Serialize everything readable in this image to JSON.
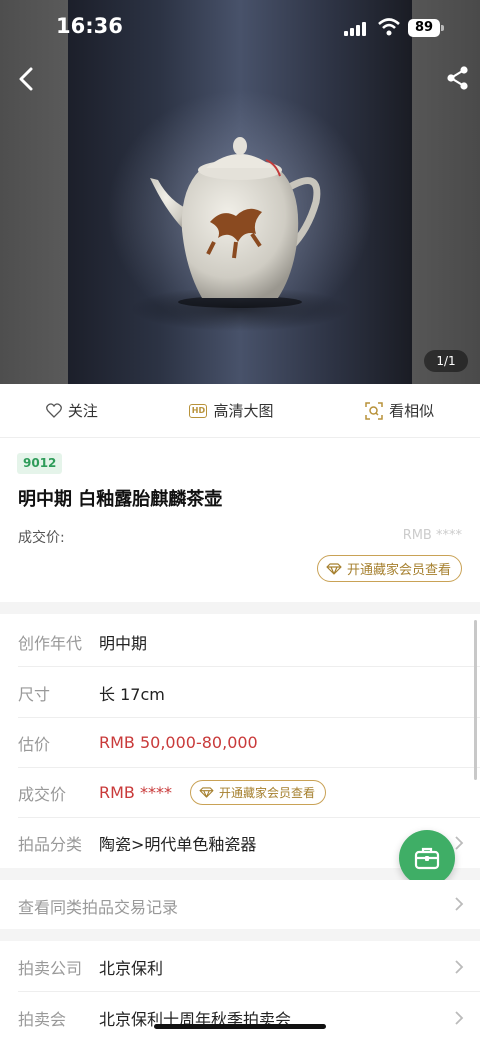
{
  "status_bar": {
    "time": "16:36",
    "battery": "89"
  },
  "hero": {
    "image_counter": "1/1"
  },
  "actions": [
    {
      "label": "关注",
      "icon": "heart-outline-icon"
    },
    {
      "label": "高清大图",
      "icon": "hd-icon",
      "icon_text": "HD"
    },
    {
      "label": "看相似",
      "icon": "similar-search-icon"
    }
  ],
  "lot": {
    "number": "9012",
    "title": "明中期 白釉露胎麒麟茶壶",
    "deal_price_label": "成交价:",
    "deal_price_masked": "RMB ****",
    "vip_button": "开通藏家会员查看"
  },
  "details": {
    "rows": [
      {
        "label": "创作年代",
        "value": "明中期"
      },
      {
        "label": "尺寸",
        "value": "长 17cm"
      },
      {
        "label": "估价",
        "value": "RMB  50,000-80,000"
      },
      {
        "label": "成交价",
        "value": "RMB ****",
        "vip_button": "开通藏家会员查看"
      },
      {
        "label": "拍品分类",
        "value": "陶瓷>明代单色釉瓷器"
      }
    ]
  },
  "history": {
    "label": "查看同类拍品交易记录"
  },
  "company": {
    "rows": [
      {
        "label": "拍卖公司",
        "value": "北京保利"
      },
      {
        "label": "拍卖会",
        "value": "北京保利十周年秋季拍卖会"
      }
    ]
  },
  "colors": {
    "accent_green": "#3fae66",
    "price_red": "#c93a3a",
    "vip_gold": "#a6802f"
  }
}
